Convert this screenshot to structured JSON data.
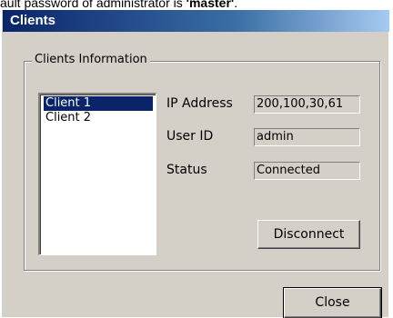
{
  "doc_caption": {
    "prefix": "ault password of administrator is ",
    "bold": "'master'",
    "suffix": "."
  },
  "window": {
    "title": "Clients"
  },
  "group": {
    "legend": "Clients Information"
  },
  "clients_list": {
    "items": [
      {
        "label": "Client 1",
        "selected": true
      },
      {
        "label": "Client 2",
        "selected": false
      }
    ]
  },
  "fields": {
    "ip_address": {
      "label": "IP Address",
      "value": "200,100,30,61"
    },
    "user_id": {
      "label": "User ID",
      "value": "admin"
    },
    "status": {
      "label": "Status",
      "value": "Connected"
    }
  },
  "buttons": {
    "disconnect": "Disconnect",
    "close": "Close"
  },
  "colors": {
    "titlebar_start": "#0a246a",
    "titlebar_end": "#a6caf0",
    "dialog_face": "#d4d0c8",
    "selection": "#0a246a"
  }
}
